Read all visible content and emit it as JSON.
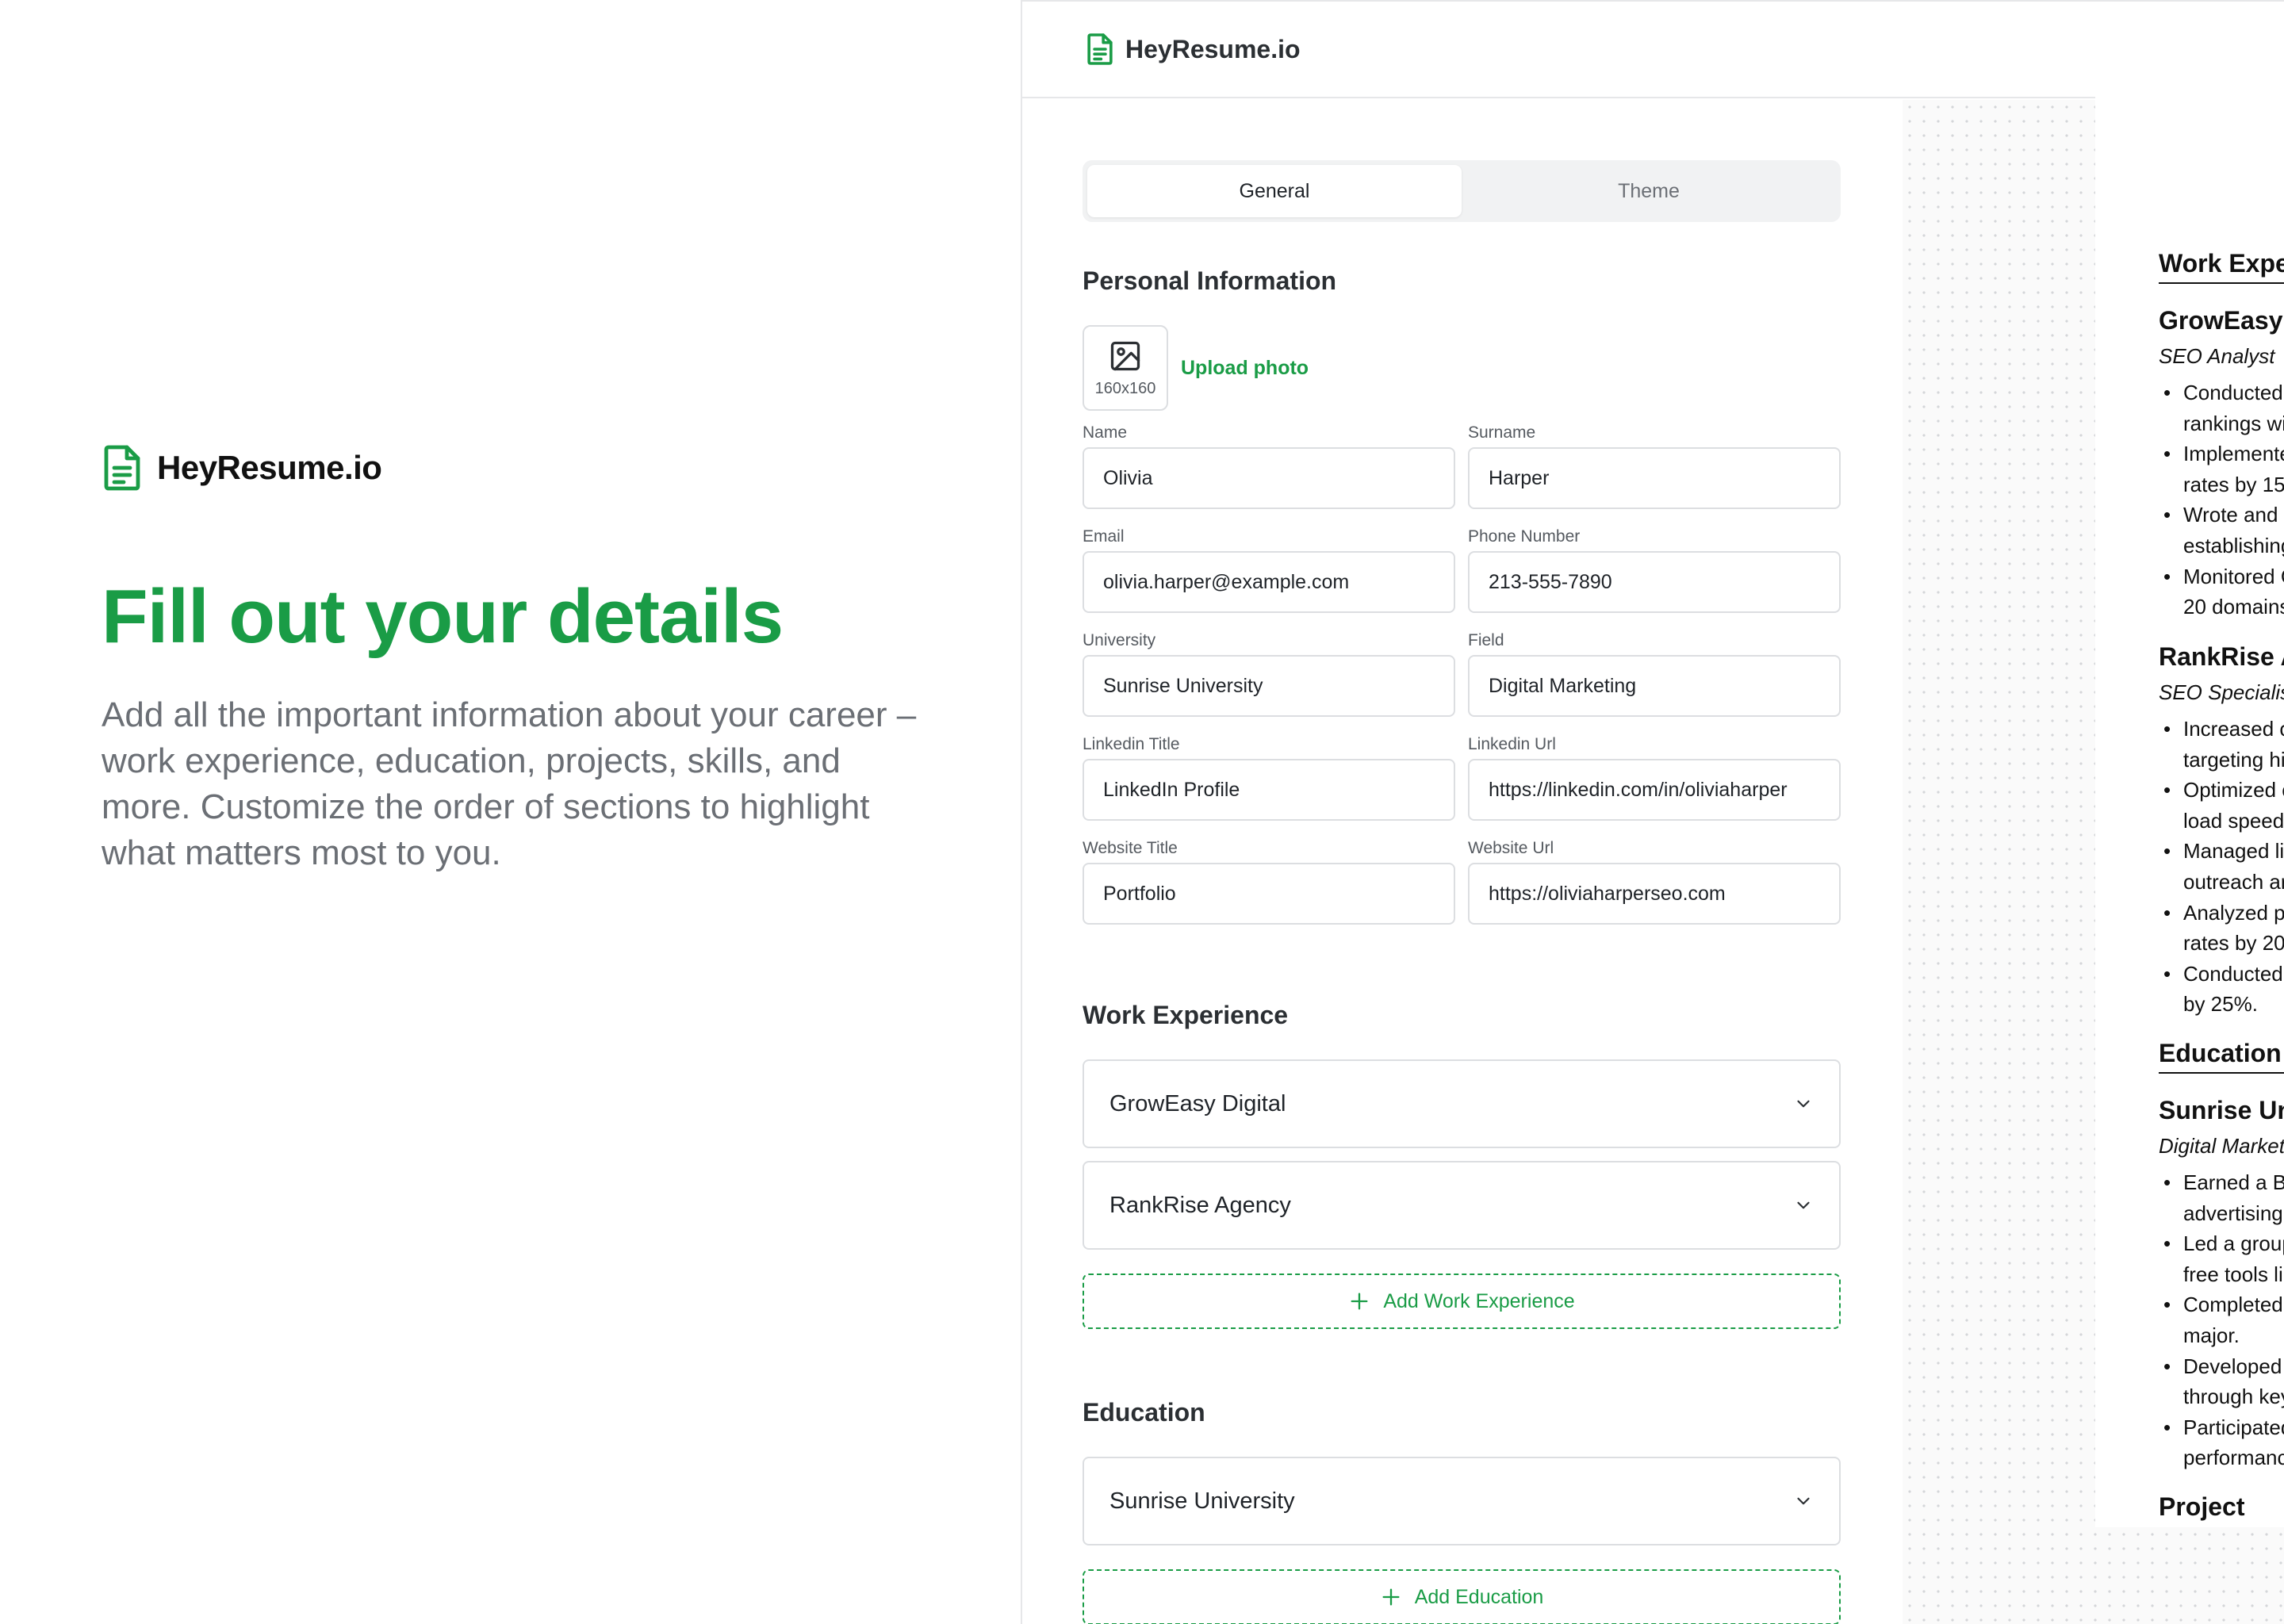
{
  "brand": {
    "name": "HeyResume.io"
  },
  "marketing": {
    "headline": "Fill out your details",
    "subcopy": "Add all the important information about your career – work experience, education, projects, skills, and more. Customize the order of sections to highlight what matters most to you."
  },
  "tabs": [
    {
      "label": "General",
      "active": true
    },
    {
      "label": "Theme",
      "active": false
    }
  ],
  "personal": {
    "title": "Personal Information",
    "photo_size": "160x160",
    "upload_label": "Upload photo",
    "fields": {
      "name": {
        "label": "Name",
        "value": "Olivia"
      },
      "surname": {
        "label": "Surname",
        "value": "Harper"
      },
      "email": {
        "label": "Email",
        "value": "olivia.harper@example.com"
      },
      "phone": {
        "label": "Phone Number",
        "value": "213-555-7890"
      },
      "university": {
        "label": "University",
        "value": "Sunrise University"
      },
      "field": {
        "label": "Field",
        "value": "Digital Marketing"
      },
      "linkedin_title": {
        "label": "Linkedin Title",
        "value": "LinkedIn Profile"
      },
      "linkedin_url": {
        "label": "Linkedin Url",
        "value": "https://linkedin.com/in/oliviaharper"
      },
      "website_title": {
        "label": "Website Title",
        "value": "Portfolio"
      },
      "website_url": {
        "label": "Website Url",
        "value": "https://oliviaharperseo.com"
      }
    }
  },
  "work": {
    "title": "Work Experience",
    "items": [
      "GrowEasy Digital",
      "RankRise Agency"
    ],
    "add_label": "Add Work Experience"
  },
  "education": {
    "title": "Education",
    "items": [
      "Sunrise University"
    ],
    "add_label": "Add Education"
  },
  "preview": {
    "work_title": "Work Expe",
    "company1": "GrowEasy I",
    "role1": "SEO Analyst",
    "c1_lines": [
      "Conducted",
      "rankings wit",
      "Implemente",
      "rates by 15%",
      "Wrote and c",
      "establishing",
      "Monitored G",
      "20 domains"
    ],
    "company2": "RankRise A",
    "role2": "SEO Specialis",
    "c2_lines": [
      "Increased o",
      "targeting hi",
      "Optimized c",
      "load speed",
      "Managed lin",
      "outreach ar",
      "Analyzed pe",
      "rates by 20%",
      "Conducted",
      "by 25%."
    ],
    "edu_title": "Education",
    "school": "Sunrise Un",
    "degree": "Digital Market",
    "edu_lines": [
      "Earned a B.",
      "advertising.",
      "Led a group",
      "free tools lik",
      "Completed",
      "major.",
      "Developed",
      "through key",
      "Participated",
      "performanc"
    ],
    "next_title": "Project"
  }
}
